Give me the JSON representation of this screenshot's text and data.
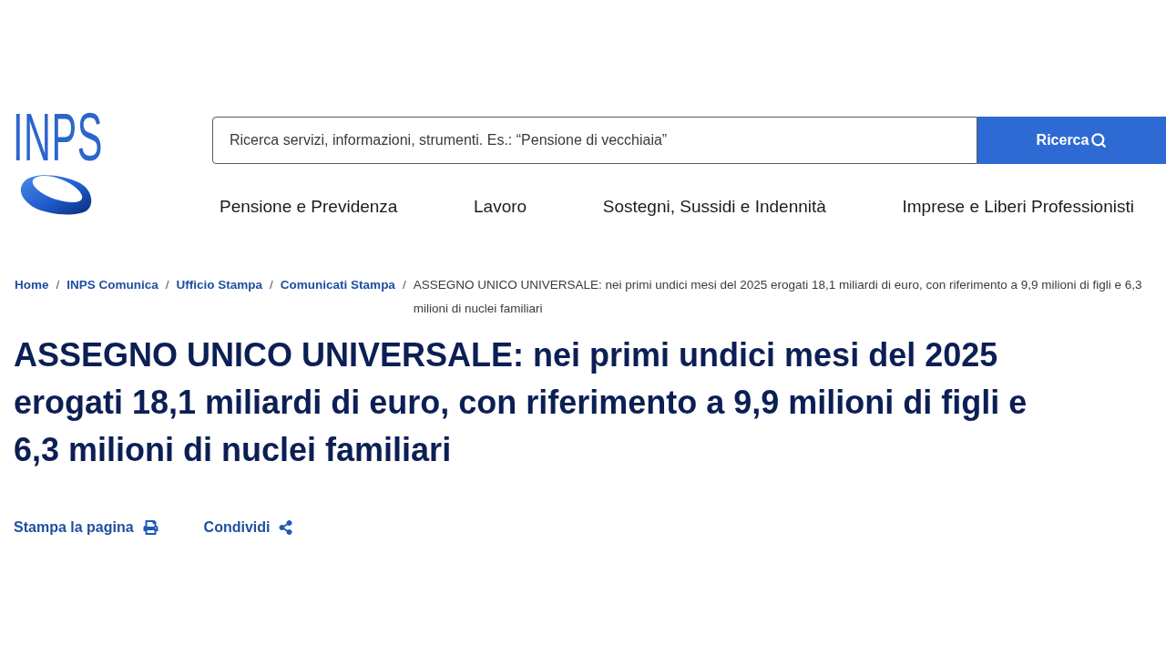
{
  "logo": {
    "text": "INPS"
  },
  "search": {
    "placeholder": "Ricerca servizi, informazioni, strumenti. Es.: “Pensione di vecchiaia”",
    "button": "Ricerca"
  },
  "nav": {
    "items": [
      {
        "label": "Pensione e Previdenza"
      },
      {
        "label": "Lavoro"
      },
      {
        "label": "Sostegni, Sussidi e Indennità"
      },
      {
        "label": "Imprese e Liberi Professionisti"
      }
    ]
  },
  "breadcrumb": {
    "separator": "/",
    "items": [
      {
        "label": "Home",
        "kind": "link"
      },
      {
        "label": "INPS Comunica",
        "kind": "link"
      },
      {
        "label": "Ufficio Stampa",
        "kind": "link"
      },
      {
        "label": "Comunicati Stampa",
        "kind": "link"
      },
      {
        "label": "ASSEGNO UNICO UNIVERSALE: nei primi undici mesi del 2025 erogati 18,1 miliardi di euro, con riferimento a 9,9 milioni di figli e 6,3 milioni di nuclei familiari",
        "kind": "current"
      }
    ]
  },
  "title": "ASSEGNO UNICO UNIVERSALE: nei primi undici mesi del 2025 erogati 18,1 miliardi di euro, con riferimento a 9,9 milioni di figli e 6,3 milioni di nuclei familiari",
  "actions": [
    {
      "label": "Stampa la pagina",
      "kind": "print"
    },
    {
      "label": "Condividi",
      "kind": "share"
    }
  ]
}
